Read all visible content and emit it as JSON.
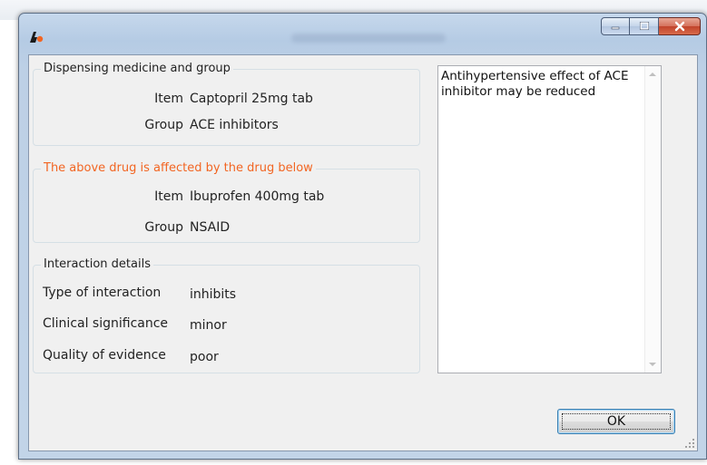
{
  "window": {
    "title": ""
  },
  "dispensing_group": {
    "legend": "Dispensing medicine and group",
    "item_label": "Item",
    "item_value": "Captopril 25mg tab",
    "group_label": "Group",
    "group_value": "ACE inhibitors"
  },
  "affected_group": {
    "legend": "The above drug is affected by the drug below",
    "legend_color": "#f26522",
    "item_label": "Item",
    "item_value": "Ibuprofen 400mg tab",
    "group_label": "Group",
    "group_value": "NSAID"
  },
  "interaction_group": {
    "legend": "Interaction details",
    "type_label": "Type of interaction",
    "type_value": "inhibits",
    "significance_label": "Clinical significance",
    "significance_value": "minor",
    "evidence_label": "Quality of evidence",
    "evidence_value": "poor"
  },
  "notes": {
    "text": "Antihypertensive effect of ACE inhibitor may be reduced"
  },
  "buttons": {
    "ok_label": "OK"
  }
}
